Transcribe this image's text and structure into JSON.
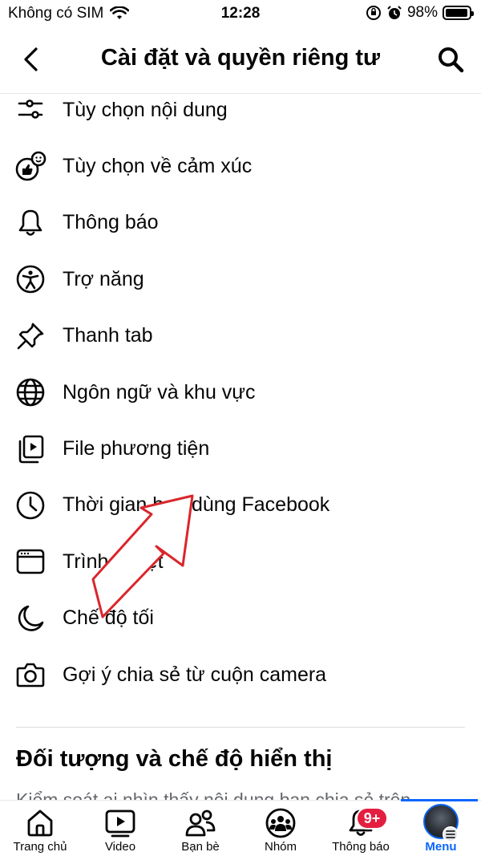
{
  "status_bar": {
    "carrier": "Không có SIM",
    "time": "12:28",
    "battery": "98%",
    "battery_level": 0.98
  },
  "header": {
    "title": "Cài đặt và quyền riêng tư",
    "back_icon": "chevron-left-icon",
    "search_icon": "search-icon"
  },
  "menu_items": [
    {
      "label": "Tùy chọn nội dung",
      "icon": "sliders-icon"
    },
    {
      "label": "Tùy chọn về cảm xúc",
      "icon": "reactions-icon"
    },
    {
      "label": "Thông báo",
      "icon": "bell-icon"
    },
    {
      "label": "Trợ năng",
      "icon": "accessibility-icon"
    },
    {
      "label": "Thanh tab",
      "icon": "pin-icon"
    },
    {
      "label": "Ngôn ngữ và khu vực",
      "icon": "globe-icon"
    },
    {
      "label": "File phương tiện",
      "icon": "media-file-icon"
    },
    {
      "label": "Thời gian bạn dùng Facebook",
      "icon": "clock-icon"
    },
    {
      "label": "Trình duyệt",
      "icon": "browser-icon"
    },
    {
      "label": "Chế độ tối",
      "icon": "moon-icon"
    },
    {
      "label": "Gợi ý chia sẻ từ cuộn camera",
      "icon": "camera-icon"
    }
  ],
  "section": {
    "title": "Đối tượng và chế độ hiển thị",
    "subtitle": "Kiểm soát ai nhìn thấy nội dung bạn chia sẻ trên"
  },
  "tab_bar": {
    "tabs": [
      {
        "label": "Trang chủ",
        "icon": "home-icon"
      },
      {
        "label": "Video",
        "icon": "video-icon"
      },
      {
        "label": "Bạn bè",
        "icon": "friends-icon"
      },
      {
        "label": "Nhóm",
        "icon": "groups-icon"
      },
      {
        "label": "Thông báo",
        "icon": "bell-icon",
        "badge": "9+"
      },
      {
        "label": "Menu",
        "icon": "avatar-icon",
        "active": true
      }
    ]
  },
  "colors": {
    "accent": "#0866ff",
    "badge": "#e41e3f",
    "annotation_arrow": "#d9262c"
  }
}
